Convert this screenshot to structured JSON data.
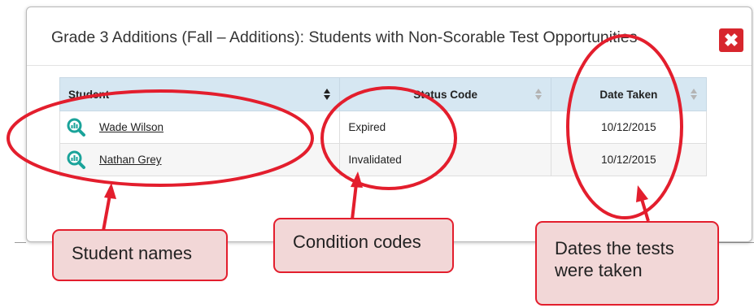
{
  "modal": {
    "title": "Grade 3 Additions (Fall – Additions): Students with Non-Scorable Test Opportunities",
    "close_glyph": "✖"
  },
  "table": {
    "columns": [
      {
        "label": "Student",
        "sort": "active"
      },
      {
        "label": "Status Code",
        "sort": "inactive"
      },
      {
        "label": "Date Taken",
        "sort": "inactive"
      }
    ],
    "rows": [
      {
        "student": "Wade Wilson",
        "status": "Expired",
        "date": "10/12/2015"
      },
      {
        "student": "Nathan Grey",
        "status": "Invalidated",
        "date": "10/12/2015"
      }
    ]
  },
  "callouts": {
    "student_names": "Student names",
    "condition_codes": "Condition codes",
    "dates_line1": "Dates the tests",
    "dates_line2": "were taken"
  },
  "icons": {
    "row_icon": "magnifier-chart-icon",
    "close": "close-icon",
    "sort": "sort-arrows-icon"
  },
  "colors": {
    "header_bg": "#d6e7f2",
    "close_red": "#d7262d",
    "annotation_red": "#e31e2d",
    "callout_fill": "#f2d7d7",
    "icon_teal": "#1aa39a"
  }
}
